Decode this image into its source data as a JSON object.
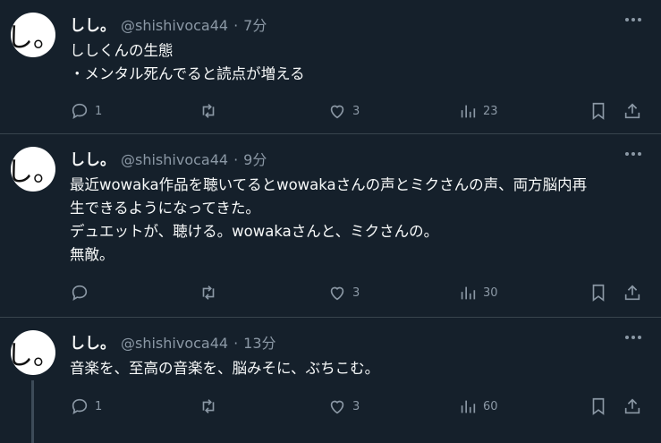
{
  "tweets": [
    {
      "name": "しし。",
      "handle": "@shishivoca44",
      "sep": "·",
      "time": "7分",
      "avatar_text": "し。",
      "text": "ししくんの生態\n・メンタル死んでると読点が増える",
      "replies": "1",
      "retweets": "",
      "likes": "3",
      "views": "23"
    },
    {
      "name": "しし。",
      "handle": "@shishivoca44",
      "sep": "·",
      "time": "9分",
      "avatar_text": "し。",
      "text": "最近wowaka作品を聴いてるとwowakaさんの声とミクさんの声、両方脳内再\n生できるようになってきた。\nデュエットが、聴ける。wowakaさんと、ミクさんの。\n無敵。",
      "replies": "",
      "retweets": "",
      "likes": "3",
      "views": "30"
    },
    {
      "name": "しし。",
      "handle": "@shishivoca44",
      "sep": "·",
      "time": "13分",
      "avatar_text": "し。",
      "text": "音楽を、至高の音楽を、脳みそに、ぶちこむ。",
      "replies": "1",
      "retweets": "",
      "likes": "3",
      "views": "60"
    }
  ],
  "colors": {
    "background": "#15202b",
    "text": "#f7f9f9",
    "muted": "#8b98a5",
    "divider": "#38444d"
  },
  "icons": [
    "reply-icon",
    "retweet-icon",
    "like-icon",
    "views-icon",
    "bookmark-icon",
    "share-icon",
    "more-icon"
  ]
}
